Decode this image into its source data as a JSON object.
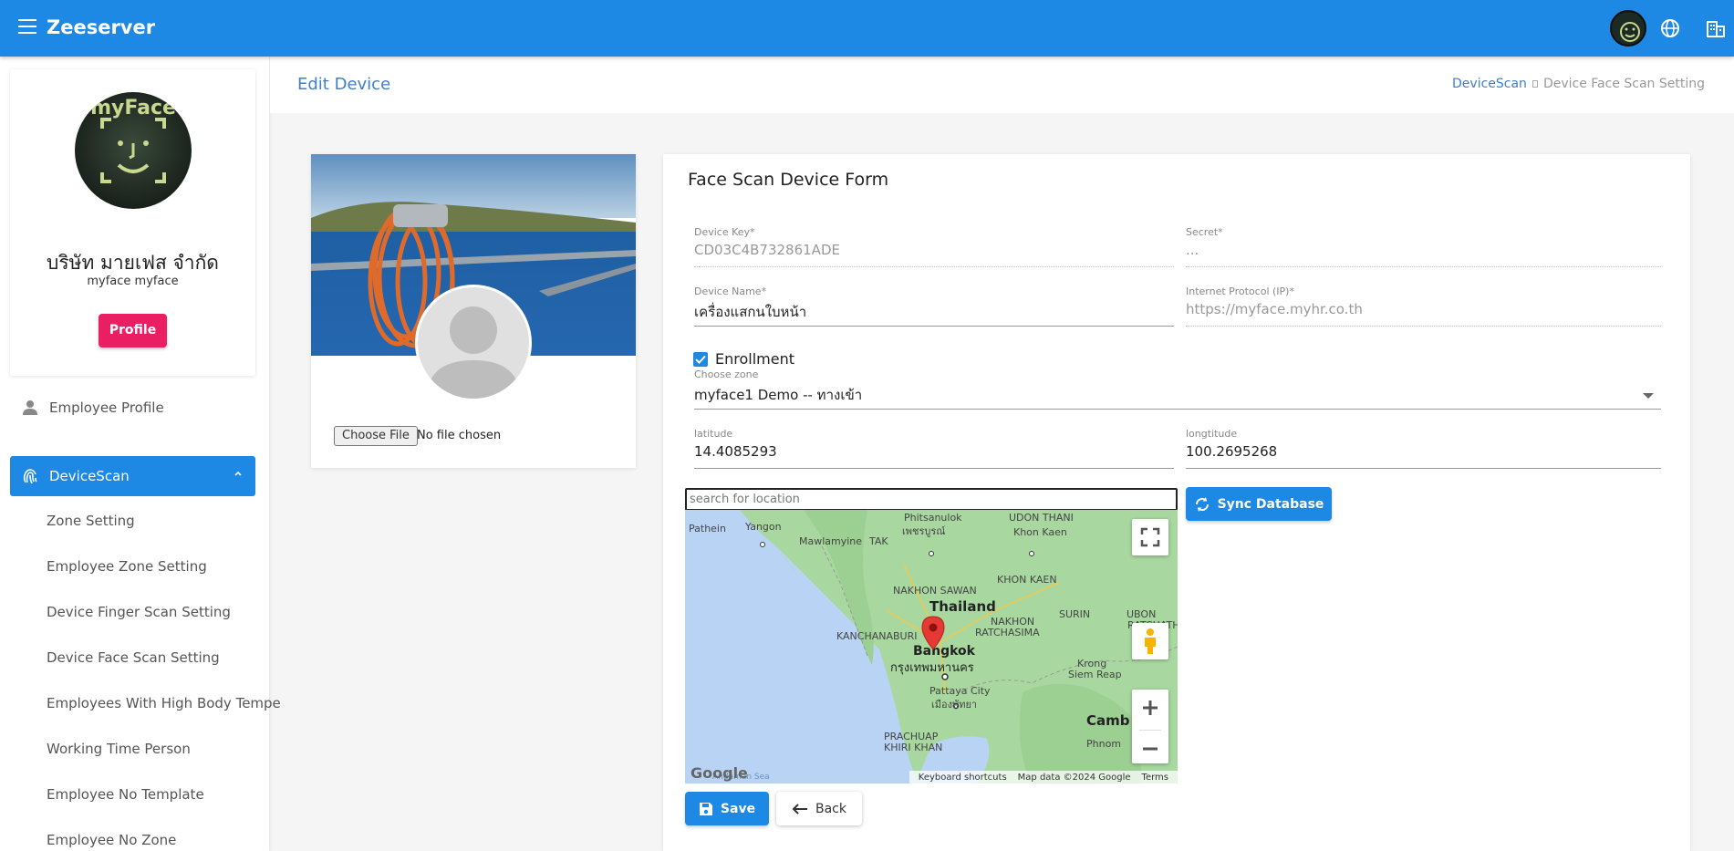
{
  "app": {
    "title": "Zeeserver"
  },
  "sidebar": {
    "company_name": "บริษัท มายเฟส จำกัด",
    "company_sub": "myface myface",
    "avatar_text": "myFace",
    "profile_button": "Profile",
    "items": [
      {
        "label": "Employee Profile",
        "icon": "person-icon"
      },
      {
        "label": "DeviceScan",
        "icon": "fingerprint-icon",
        "active": true
      }
    ],
    "subitems": [
      "Zone Setting",
      "Employee Zone Setting",
      "Device Finger Scan Setting",
      "Device Face Scan Setting",
      "Employees With High Body Tempe",
      "Working Time Person",
      "Employee No Template",
      "Employee No Zone"
    ]
  },
  "header": {
    "title": "Edit Device",
    "breadcrumb": {
      "parent": "DeviceScan",
      "current": "Device Face Scan Setting"
    }
  },
  "photo_card": {
    "file_button": "Choose File",
    "file_status": "No file chosen"
  },
  "form": {
    "title": "Face Scan Device Form",
    "device_key": {
      "label": "Device Key*",
      "value": "CD03C4B732861ADE"
    },
    "secret": {
      "label": "Secret*",
      "value": "..."
    },
    "device_name": {
      "label": "Device Name*",
      "value": "เครื่องแสกนใบหน้า"
    },
    "ip": {
      "label": "Internet Protocol (IP)*",
      "value": "https://myface.myhr.co.th"
    },
    "enrollment": {
      "label": "Enrollment",
      "checked": true
    },
    "zone": {
      "label": "Choose zone",
      "value": "myface1 Demo -- ทางเข้า"
    },
    "latitude": {
      "label": "latitude",
      "value": "14.4085293"
    },
    "longitude": {
      "label": "longtitude",
      "value": "100.2695268"
    },
    "search_placeholder": "search for location",
    "sync_button": "Sync Database",
    "save_button": "Save",
    "back_button": "Back"
  },
  "map": {
    "labels": {
      "phitsanulok": "Phitsanulok",
      "phitsanulok_th": "เพชรบูรณ์",
      "udon": "UDON THANI",
      "pathein": "Pathein",
      "yangon": "Yangon",
      "mawlamyine": "Mawlamyine",
      "tak": "TAK",
      "khonkaen1": "Khon Kaen",
      "khonkaen2": "KHON KAEN",
      "nakhon_sawan": "NAKHON SAWAN",
      "thailand": "Thailand",
      "surin": "SURIN",
      "ubon": "UBON",
      "ratchathani": "RATCHATHANI",
      "nakhon": "NAKHON",
      "ratchasima": "RATCHASIMA",
      "kanchanaburi": "KANCHANABURI",
      "bangkok": "Bangkok",
      "bangkok_th": "กรุงเทพมหานคร",
      "krong": "Krong",
      "siem_reap": "Siem Reap",
      "pattaya": "Pattaya City",
      "pattaya_th": "เมืองพัทยา",
      "cambodia": "Camb",
      "prachuap": "PRACHUAP",
      "khiri_khan": "KHIRI KHAN",
      "phnom": "Phnom",
      "andaman": "Andaman Sea"
    },
    "google": "Google",
    "footer": {
      "shortcuts": "Keyboard shortcuts",
      "data": "Map data ©2024 Google",
      "terms": "Terms"
    }
  },
  "colors": {
    "primary": "#1e88e5",
    "accent": "#e91e63",
    "map_water": "#b9d3f5",
    "map_land": "#a8d8a0"
  }
}
